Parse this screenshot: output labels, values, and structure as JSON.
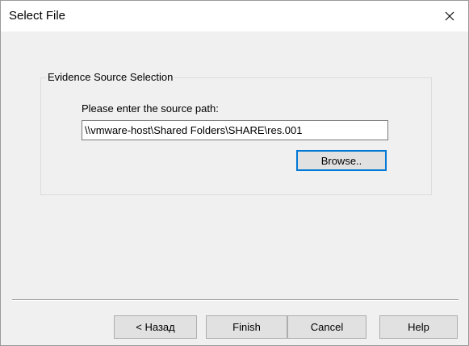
{
  "window": {
    "title": "Select File"
  },
  "group": {
    "legend": "Evidence Source Selection",
    "source_label": "Please enter the source path:",
    "source_value": "\\\\vmware-host\\Shared Folders\\SHARE\\res.001",
    "browse_label": "Browse.."
  },
  "footer": {
    "back_label": "< Назад",
    "finish_label": "Finish",
    "cancel_label": "Cancel",
    "help_label": "Help"
  },
  "icons": {
    "close": "close-icon"
  },
  "colors": {
    "focus_border": "#0078d7",
    "dialog_bg": "#f0f0f0",
    "button_bg": "#e1e1e1"
  }
}
